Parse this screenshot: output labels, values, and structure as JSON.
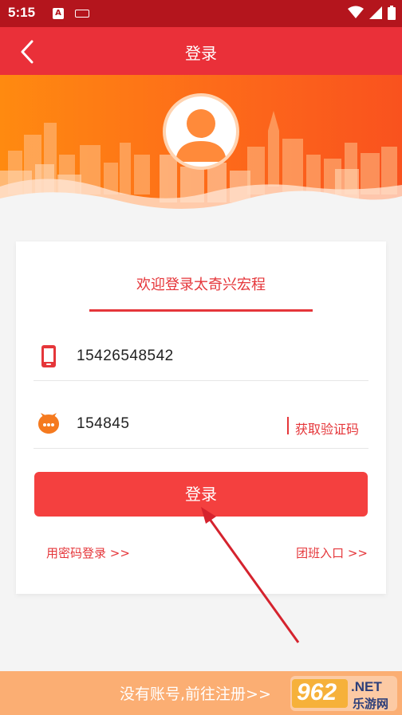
{
  "status_bar": {
    "time": "5:15",
    "icons": [
      "a-icon",
      "keyboard-icon",
      "wifi-icon",
      "signal-icon",
      "battery-icon"
    ]
  },
  "header": {
    "title": "登录",
    "back_icon": "chevron-left-icon"
  },
  "form": {
    "welcome_text": "欢迎登录太奇兴宏程",
    "phone": {
      "icon": "phone-icon",
      "value": "15426548542"
    },
    "code": {
      "icon": "chat-bubble-icon",
      "value": "154845",
      "get_code_label": "获取验证码"
    },
    "login_label": "登录",
    "password_login_link": "用密码登录 >>",
    "group_entry_link": "团班入口 >>"
  },
  "footer": {
    "register_text": "没有账号,前往注册>>"
  },
  "watermark": {
    "number": "962",
    "suffix": ".NET",
    "caption": "乐游网"
  },
  "colors": {
    "primary_red": "#ea3039",
    "status_bar": "#b4151d",
    "banner_orange": "#ff8a10",
    "button_red": "#f4403f",
    "footer_orange": "#fbae73"
  }
}
